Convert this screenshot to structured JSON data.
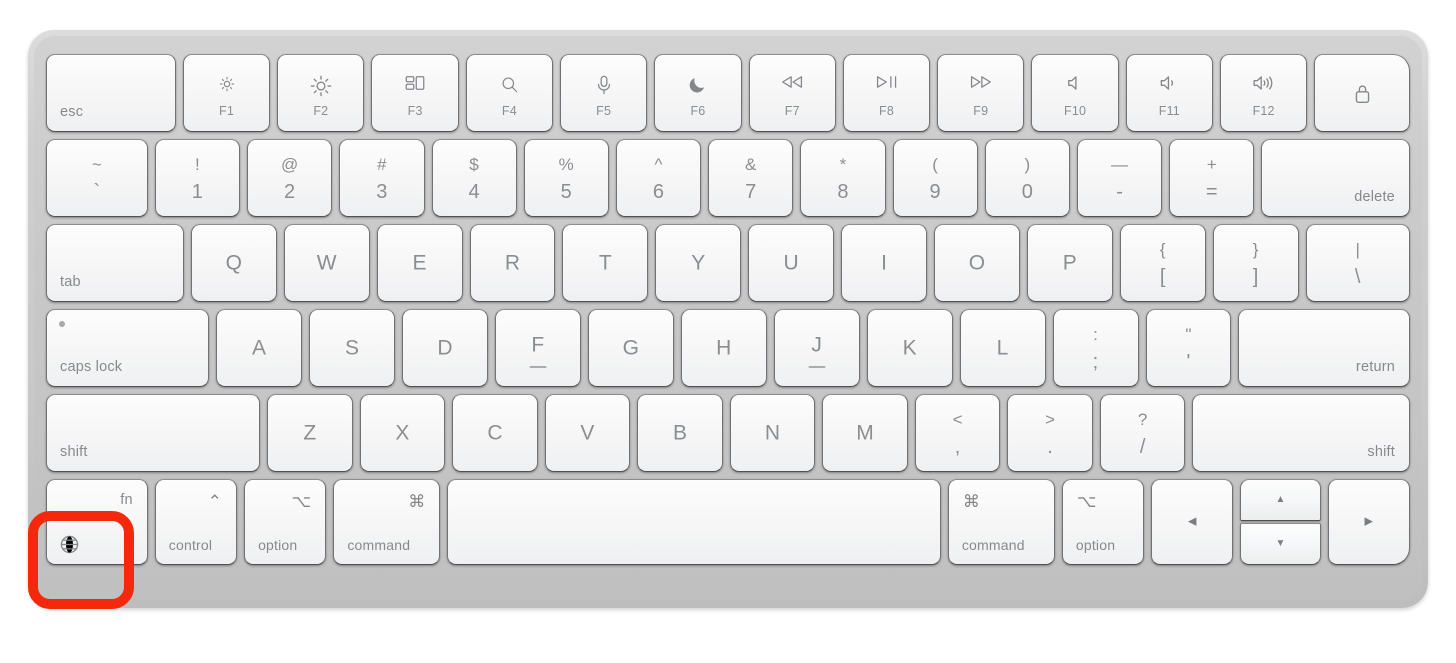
{
  "device": {
    "name": "Apple Magic Keyboard with Touch ID",
    "layout": "US English",
    "case_color": "#c8c8c8",
    "key_color": "#f7f7f8",
    "legend_color": "#8a8d90"
  },
  "annotation": {
    "type": "highlight-rectangle",
    "target_key": "fn",
    "color": "#f4290c",
    "shape": "rounded-rectangle",
    "border_width_px": 10
  },
  "rows": {
    "function": [
      {
        "id": "esc",
        "label": "esc",
        "align": "bottom-left",
        "width": "w-esc"
      },
      {
        "id": "f1",
        "fkey": "F1",
        "icon": "brightness-down-icon",
        "width": "w-f"
      },
      {
        "id": "f2",
        "fkey": "F2",
        "icon": "brightness-up-icon",
        "width": "w-f"
      },
      {
        "id": "f3",
        "fkey": "F3",
        "icon": "mission-control-icon",
        "width": "w-f"
      },
      {
        "id": "f4",
        "fkey": "F4",
        "icon": "spotlight-search-icon",
        "width": "w-f"
      },
      {
        "id": "f5",
        "fkey": "F5",
        "icon": "dictation-mic-icon",
        "width": "w-f"
      },
      {
        "id": "f6",
        "fkey": "F6",
        "icon": "do-not-disturb-moon-icon",
        "width": "w-f"
      },
      {
        "id": "f7",
        "fkey": "F7",
        "icon": "rewind-icon",
        "width": "w-f"
      },
      {
        "id": "f8",
        "fkey": "F8",
        "icon": "play-pause-icon",
        "width": "w-f"
      },
      {
        "id": "f9",
        "fkey": "F9",
        "icon": "fast-forward-icon",
        "width": "w-f"
      },
      {
        "id": "f10",
        "fkey": "F10",
        "icon": "mute-icon",
        "width": "w-f"
      },
      {
        "id": "f11",
        "fkey": "F11",
        "icon": "volume-down-icon",
        "width": "w-f"
      },
      {
        "id": "f12",
        "fkey": "F12",
        "icon": "volume-up-icon",
        "width": "w-f"
      },
      {
        "id": "touchid",
        "fkey": "",
        "icon": "lock-touchid-icon",
        "width": "w-lock"
      }
    ],
    "number": [
      {
        "id": "tilde",
        "top": "~",
        "bottom": "`",
        "width": "w-tilde"
      },
      {
        "id": "one",
        "top": "!",
        "bottom": "1",
        "width": "w-num"
      },
      {
        "id": "two",
        "top": "@",
        "bottom": "2",
        "width": "w-num"
      },
      {
        "id": "three",
        "top": "#",
        "bottom": "3",
        "width": "w-num"
      },
      {
        "id": "four",
        "top": "$",
        "bottom": "4",
        "width": "w-num"
      },
      {
        "id": "five",
        "top": "%",
        "bottom": "5",
        "width": "w-num"
      },
      {
        "id": "six",
        "top": "^",
        "bottom": "6",
        "width": "w-num"
      },
      {
        "id": "seven",
        "top": "&",
        "bottom": "7",
        "width": "w-num"
      },
      {
        "id": "eight",
        "top": "*",
        "bottom": "8",
        "width": "w-num"
      },
      {
        "id": "nine",
        "top": "(",
        "bottom": "9",
        "width": "w-num"
      },
      {
        "id": "zero",
        "top": ")",
        "bottom": "0",
        "width": "w-num"
      },
      {
        "id": "minus",
        "top": "—",
        "bottom": "-",
        "width": "w-num"
      },
      {
        "id": "equal",
        "top": "+",
        "bottom": "=",
        "width": "w-num"
      },
      {
        "id": "delete",
        "label": "delete",
        "align": "bottom-right",
        "width": "w-delete"
      }
    ],
    "qwerty": [
      {
        "id": "tab",
        "label": "tab",
        "align": "bottom-left",
        "width": "w-tab"
      },
      {
        "id": "q",
        "letter": "Q",
        "width": "w-alpha"
      },
      {
        "id": "w",
        "letter": "W",
        "width": "w-alpha"
      },
      {
        "id": "e",
        "letter": "E",
        "width": "w-alpha"
      },
      {
        "id": "r",
        "letter": "R",
        "width": "w-alpha"
      },
      {
        "id": "t",
        "letter": "T",
        "width": "w-alpha"
      },
      {
        "id": "y",
        "letter": "Y",
        "width": "w-alpha"
      },
      {
        "id": "u",
        "letter": "U",
        "width": "w-alpha"
      },
      {
        "id": "i",
        "letter": "I",
        "width": "w-alpha"
      },
      {
        "id": "o",
        "letter": "O",
        "width": "w-alpha"
      },
      {
        "id": "p",
        "letter": "P",
        "width": "w-alpha"
      },
      {
        "id": "lbracket",
        "top": "{",
        "bottom": "[",
        "width": "w-alpha"
      },
      {
        "id": "rbracket",
        "top": "}",
        "bottom": "]",
        "width": "w-alpha"
      },
      {
        "id": "backslash",
        "top": "|",
        "bottom": "\\",
        "width": "w-backsl"
      }
    ],
    "home": [
      {
        "id": "capslock",
        "label": "caps lock",
        "align": "bottom-left",
        "led": true,
        "width": "w-caps"
      },
      {
        "id": "a",
        "letter": "A",
        "width": "w-alpha"
      },
      {
        "id": "s",
        "letter": "S",
        "width": "w-alpha"
      },
      {
        "id": "d",
        "letter": "D",
        "width": "w-alpha"
      },
      {
        "id": "f",
        "letter": "F",
        "homebar": true,
        "width": "w-alpha"
      },
      {
        "id": "g",
        "letter": "G",
        "width": "w-alpha"
      },
      {
        "id": "h",
        "letter": "H",
        "width": "w-alpha"
      },
      {
        "id": "j",
        "letter": "J",
        "homebar": true,
        "width": "w-alpha"
      },
      {
        "id": "k",
        "letter": "K",
        "width": "w-alpha"
      },
      {
        "id": "l",
        "letter": "L",
        "width": "w-alpha"
      },
      {
        "id": "semicolon",
        "top": ":",
        "bottom": ";",
        "width": "w-alpha"
      },
      {
        "id": "quote",
        "top": "\"",
        "bottom": "'",
        "width": "w-alpha"
      },
      {
        "id": "return",
        "label": "return",
        "align": "bottom-right",
        "width": "w-return"
      }
    ],
    "shift": [
      {
        "id": "lshift",
        "label": "shift",
        "align": "bottom-left",
        "width": "w-lshift"
      },
      {
        "id": "z",
        "letter": "Z",
        "width": "w-alpha"
      },
      {
        "id": "x",
        "letter": "X",
        "width": "w-alpha"
      },
      {
        "id": "c",
        "letter": "C",
        "width": "w-alpha"
      },
      {
        "id": "v",
        "letter": "V",
        "width": "w-alpha"
      },
      {
        "id": "b",
        "letter": "B",
        "width": "w-alpha"
      },
      {
        "id": "n",
        "letter": "N",
        "width": "w-alpha"
      },
      {
        "id": "m",
        "letter": "M",
        "width": "w-alpha"
      },
      {
        "id": "comma",
        "top": "<",
        "bottom": ",",
        "width": "w-alpha"
      },
      {
        "id": "period",
        "top": ">",
        "bottom": ".",
        "width": "w-alpha"
      },
      {
        "id": "slash",
        "top": "?",
        "bottom": "/",
        "width": "w-alpha"
      },
      {
        "id": "rshift",
        "label": "shift",
        "align": "bottom-right",
        "width": "w-rshift"
      }
    ],
    "bottom": [
      {
        "id": "fn",
        "label": "fn",
        "symbol_pos": "top-right",
        "icon": "globe-icon",
        "highlighted": true,
        "width": "w-fn"
      },
      {
        "id": "control",
        "label": "control",
        "symbol": "⌃",
        "symbol_pos": "top-right",
        "width": "w-ctrl"
      },
      {
        "id": "option-l",
        "label": "option",
        "symbol": "⌥",
        "symbol_pos": "top-right",
        "width": "w-opt"
      },
      {
        "id": "command-l",
        "label": "command",
        "symbol": "⌘",
        "symbol_pos": "top-right",
        "width": "w-cmdl"
      },
      {
        "id": "space",
        "label": "",
        "width": "w-space"
      },
      {
        "id": "command-r",
        "label": "command",
        "symbol": "⌘",
        "symbol_pos": "top-left",
        "width": "w-cmdr"
      },
      {
        "id": "option-r",
        "label": "option",
        "symbol": "⌥",
        "symbol_pos": "top-left",
        "width": "w-optr"
      },
      {
        "id": "arrow-left",
        "glyph": "◀",
        "icon": "arrow-left-icon",
        "width": "w-arrow"
      },
      {
        "id": "arrow-up",
        "glyph": "▲",
        "icon": "arrow-up-icon"
      },
      {
        "id": "arrow-down",
        "glyph": "▼",
        "icon": "arrow-down-icon"
      },
      {
        "id": "arrow-right",
        "glyph": "▶",
        "icon": "arrow-right-icon",
        "width": "w-arrow"
      }
    ]
  }
}
